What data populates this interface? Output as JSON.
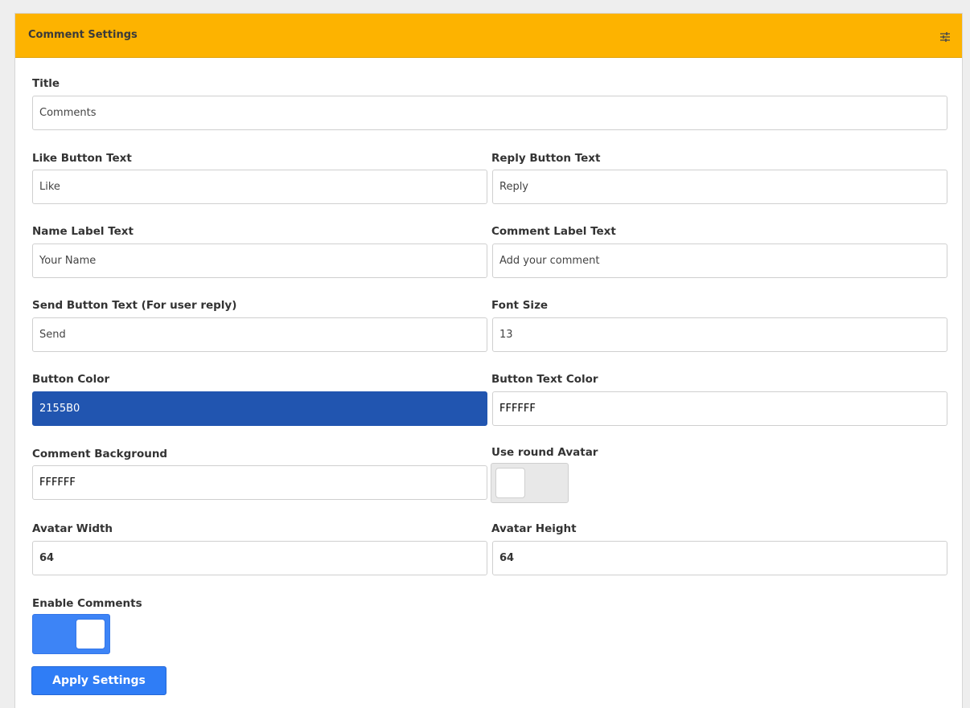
{
  "panel": {
    "title": "Comment Settings",
    "header_icon": "sliders-icon",
    "header_color": "#FDB300"
  },
  "fields": {
    "title": {
      "label": "Title",
      "value": "Comments"
    },
    "like_button_text": {
      "label": "Like Button Text",
      "value": "Like"
    },
    "reply_button_text": {
      "label": "Reply Button Text",
      "value": "Reply"
    },
    "name_label_text": {
      "label": "Name Label Text",
      "value": "Your Name"
    },
    "comment_label_text": {
      "label": "Comment Label Text",
      "value": "Add your comment"
    },
    "send_button_text": {
      "label": "Send Button Text (For user reply)",
      "value": "Send"
    },
    "font_size": {
      "label": "Font Size",
      "value": "13"
    },
    "button_color": {
      "label": "Button Color",
      "value": "2155B0",
      "swatch": "#2155B0"
    },
    "button_text_color": {
      "label": "Button Text Color",
      "value": "FFFFFF",
      "swatch": "#FFFFFF"
    },
    "comment_background": {
      "label": "Comment Background",
      "value": "FFFFFF",
      "swatch": "#FFFFFF"
    },
    "use_round_avatar": {
      "label": "Use round Avatar",
      "checked": false
    },
    "avatar_width": {
      "label": "Avatar Width",
      "value": "64"
    },
    "avatar_height": {
      "label": "Avatar Height",
      "value": "64"
    },
    "enable_comments": {
      "label": "Enable Comments",
      "checked": true,
      "on_color": "#3D84F6"
    }
  },
  "actions": {
    "apply_label": "Apply Settings",
    "apply_color": "#2F7DF6"
  }
}
